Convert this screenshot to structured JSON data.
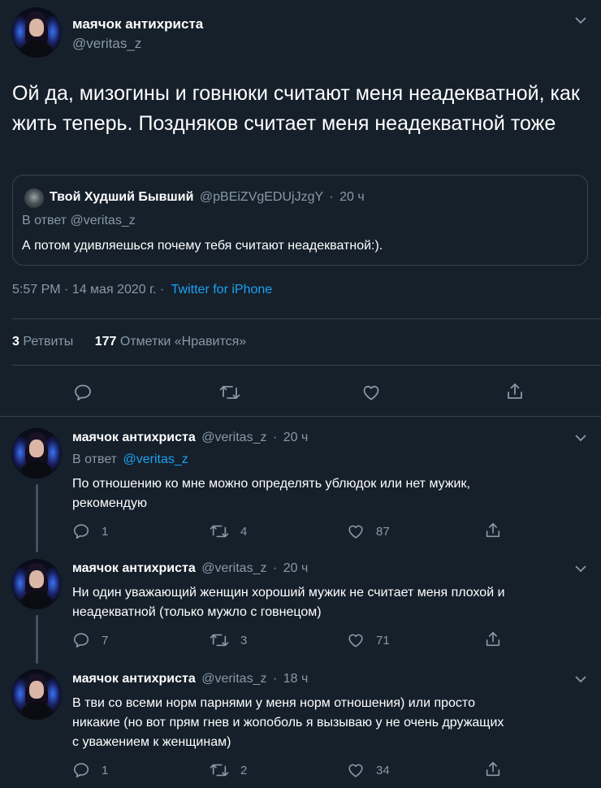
{
  "main_tweet": {
    "author_name": "маячок антихриста",
    "author_handle": "@veritas_z",
    "text": "Ой да, мизогины и говнюки считают меня неадекватной, как жить теперь. Поздняков считает меня неадекватной тоже",
    "quoted": {
      "author_name": "Твой Худший Бывший",
      "author_handle": "@pBEiZVgEDUjJzgY",
      "separator": "·",
      "time": "20 ч",
      "reply_label": "В ответ @veritas_z",
      "text": "А потом удивляешься почему тебя считают неадекватной:)."
    },
    "timestamp": "5:57 PM · 14 мая 2020 г. ·",
    "source": "Twitter for iPhone",
    "retweets_count": "3",
    "retweets_label": "Ретвиты",
    "likes_count": "177",
    "likes_label": "Отметки «Нравится»"
  },
  "replies": [
    {
      "author_name": "маячок антихриста",
      "author_handle": "@veritas_z",
      "separator": "·",
      "time": "20 ч",
      "reply_prefix": "В ответ",
      "reply_to": "@veritas_z",
      "text_line1": "По отношению ко мне можно определять ублюдок или нет мужик,",
      "text_line2": "рекомендую",
      "text_line3": "",
      "replies": "1",
      "retweets": "4",
      "likes": "87"
    },
    {
      "author_name": "маячок антихриста",
      "author_handle": "@veritas_z",
      "separator": "·",
      "time": "20 ч",
      "text_line1": "Ни один уважающий женщин хороший мужик не считает меня плохой и",
      "text_line2": "неадекватной (только мужло с говнецом)",
      "text_line3": "",
      "replies": "7",
      "retweets": "3",
      "likes": "71"
    },
    {
      "author_name": "маячок антихриста",
      "author_handle": "@veritas_z",
      "separator": "·",
      "time": "18 ч",
      "text_line1": "В тви со всеми норм парнями у меня норм отношения) или просто",
      "text_line2": "никакие (но вот прям гнев и жопоболь я вызываю у не очень дружащих",
      "text_line3": "с уважением к женщинам)",
      "replies": "1",
      "retweets": "2",
      "likes": "34"
    }
  ],
  "colors": {
    "background": "#15202b",
    "text": "#ffffff",
    "muted": "#8899a6",
    "accent": "#1da1f2",
    "border": "#38444d"
  },
  "icons": [
    "chevron-down-icon",
    "reply-icon",
    "retweet-icon",
    "like-icon",
    "share-icon"
  ]
}
